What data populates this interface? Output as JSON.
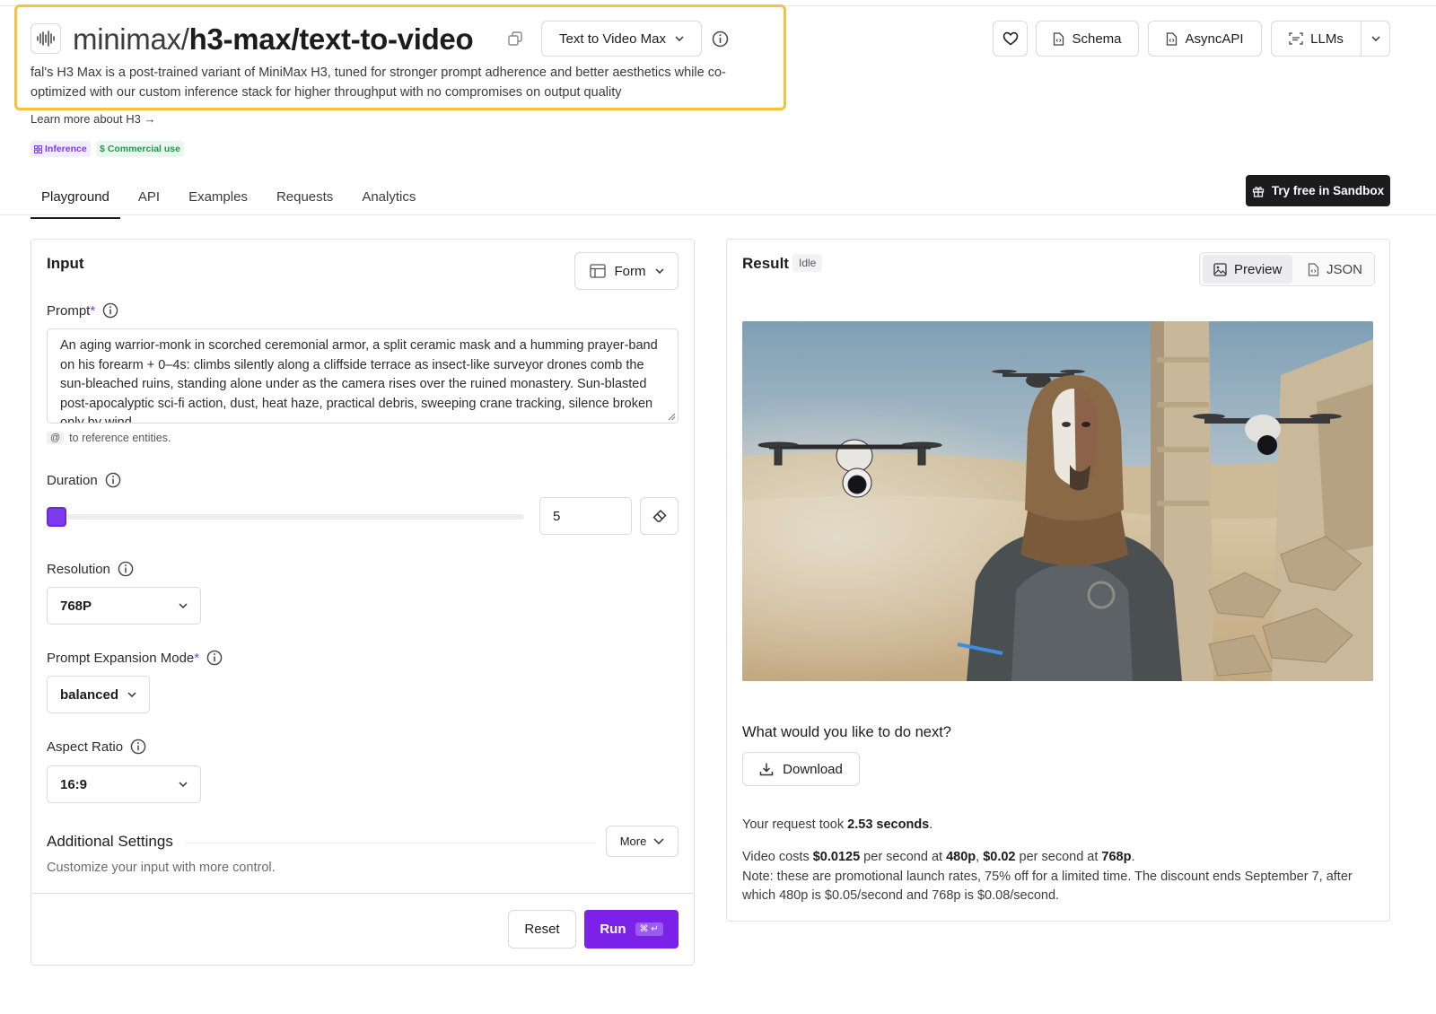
{
  "header": {
    "title_owner": "minimax/",
    "title_model": "h3-max/text-to-video",
    "variant_label": "Text to Video Max",
    "description": "fal's H3 Max is a post-trained variant of MiniMax H3, tuned for stronger prompt adherence and better aesthetics while co-optimized with our custom inference stack for higher throughput with no compromises on output quality",
    "learn_more": "Learn more about H3 →",
    "badges": [
      "Inference",
      "Commercial use"
    ],
    "actions": {
      "schema": "Schema",
      "asyncapi": "AsyncAPI",
      "llms": "LLMs"
    }
  },
  "tabs": [
    "Playground",
    "API",
    "Examples",
    "Requests",
    "Analytics"
  ],
  "sandbox_label": "Try free in Sandbox",
  "input": {
    "title": "Input",
    "mode_label": "Form",
    "prompt_label": "Prompt",
    "prompt_required": "*",
    "prompt_value": "An aging warrior-monk in scorched ceremonial armor, a split ceramic mask and a humming prayer-band on his forearm + 0–4s: climbs silently along a cliffside terrace as insect-like surveyor drones comb the sun-bleached ruins, standing alone under as the camera rises over the ruined monastery. Sun-blasted post-apocalyptic sci-fi action, dust, heat haze, practical debris, sweeping crane tracking, silence broken only by wind",
    "ref_hint_key": "@",
    "ref_hint": "to reference entities.",
    "duration_label": "Duration",
    "duration_value": "5",
    "duration_level": 0,
    "resolution_label": "Resolution",
    "resolution_value": "768P",
    "expansion_label": "Prompt Expansion Mode",
    "expansion_required": "*",
    "expansion_value": "balanced",
    "aspect_label": "Aspect Ratio",
    "aspect_value": "16:9",
    "additional_title": "Additional Settings",
    "additional_hint": "Customize your input with more control.",
    "more_label": "More",
    "reset_label": "Reset",
    "run_label": "Run",
    "run_shortcut": "⌘ ↵"
  },
  "result": {
    "title": "Result",
    "status": "Idle",
    "preview_label": "Preview",
    "json_label": "JSON",
    "next_prompt": "What would you like to do next?",
    "download_label": "Download",
    "took_prefix": "Your request took ",
    "took_value": "2.53 seconds",
    "took_suffix": ".",
    "cost_line": {
      "t1": "Video costs ",
      "p1": "$0.0125",
      "t2": " per second at ",
      "r1": "480p",
      "t3": ", ",
      "p2": "$0.02",
      "t4": " per second at ",
      "r2": "768p",
      "t5": "."
    },
    "note": "Note: these are promotional launch rates, 75% off for a limited time. The discount ends September 7, after which 480p is $0.05/second and 768p is $0.08/second."
  },
  "colors": {
    "accent": "#7c22e8",
    "highlight": "#f6c23e",
    "badge_inference": "#7c3aed",
    "badge_commercial": "#1f9a4a"
  }
}
